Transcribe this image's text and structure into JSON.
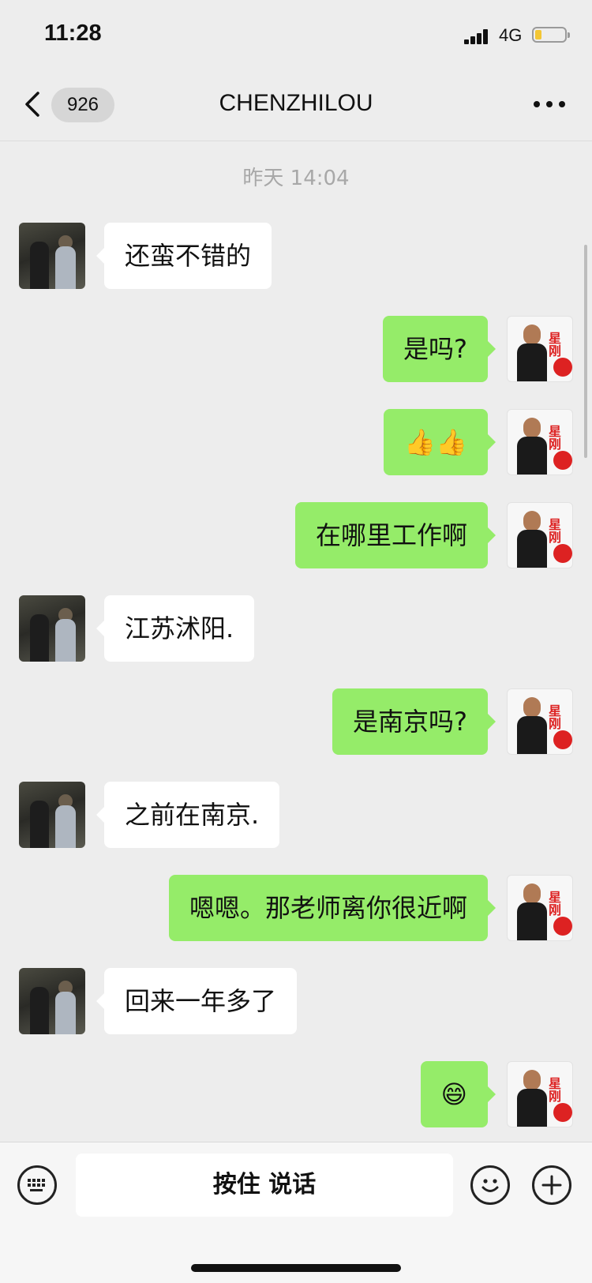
{
  "status": {
    "time": "11:28",
    "network": "4G"
  },
  "nav": {
    "unread_count": "926",
    "title": "CHENZHILOU"
  },
  "chat": {
    "timestamp": "昨天 14:04",
    "messages": [
      {
        "side": "left",
        "text": "还蛮不错的"
      },
      {
        "side": "right",
        "text": "是吗?"
      },
      {
        "side": "right",
        "text": "👍👍"
      },
      {
        "side": "right",
        "text": "在哪里工作啊"
      },
      {
        "side": "left",
        "text": "江苏沭阳."
      },
      {
        "side": "right",
        "text": "是南京吗?"
      },
      {
        "side": "left",
        "text": "之前在南京."
      },
      {
        "side": "right",
        "text": "嗯嗯。那老师离你很近啊"
      },
      {
        "side": "left",
        "text": "回来一年多了"
      },
      {
        "side": "right",
        "text": "😄"
      }
    ]
  },
  "input": {
    "voice_label": "按住 说话"
  }
}
